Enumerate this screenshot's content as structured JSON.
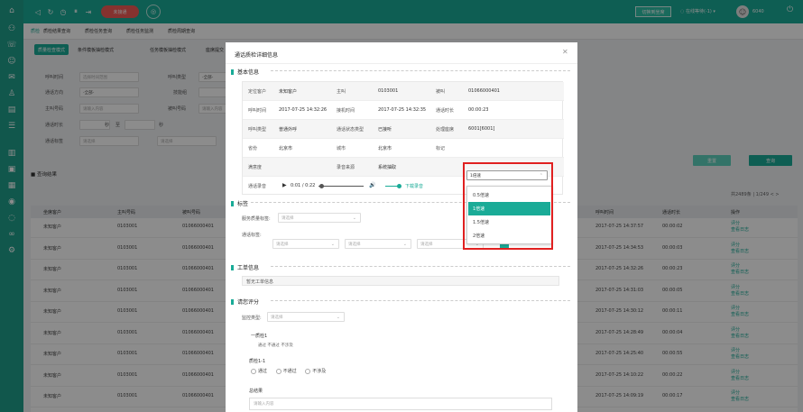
{
  "header": {
    "ringing_label": "未接通",
    "control_button": "切换到坐席",
    "status": "在线等待(-1)",
    "agent_id": "6040"
  },
  "nav_tabs": [
    "质检",
    "质检结果查询",
    "质检任务查询",
    "质检任务监测",
    "质检周期查询"
  ],
  "sub_tabs": [
    "质量检查模式",
    "条件模板抽检模式",
    "任务模板抽检模式",
    "座席提交"
  ],
  "filters": {
    "call_time_label": "呼叫时间",
    "call_time_placeholder": "选择时间范围",
    "call_type_label": "呼叫类型",
    "call_type_value": "-全部-",
    "call_direction_label": "通话方向",
    "call_direction_value": "-全部-",
    "skill_label": "技能组",
    "caller_label": "主叫号码",
    "caller_placeholder": "请输入内容",
    "called_label": "被叫号码",
    "called_placeholder": "请输入内容",
    "duration_label": "通话时长",
    "duration_sec": "秒",
    "duration_to": "至",
    "tag_label": "通话标签",
    "tag_placeholder": "请选择",
    "search_button": "查询",
    "reset_button": "重置"
  },
  "results": {
    "title": "查询结果",
    "pagination": "共2489条 | 1/249 < >"
  },
  "table": {
    "headers": [
      "坐席客户",
      "主叫号码",
      "被叫号码",
      "呼叫时间",
      "通话时长",
      "操作"
    ],
    "rows": [
      {
        "customer": "未知客户",
        "caller": "0103001",
        "called": "01066000401",
        "time": "2017-07-25 14:37:57",
        "duration": "00:00:02"
      },
      {
        "customer": "未知客户",
        "caller": "0103001",
        "called": "01066000401",
        "time": "2017-07-25 14:34:53",
        "duration": "00:00:03"
      },
      {
        "customer": "未知客户",
        "caller": "0103001",
        "called": "01066000401",
        "time": "2017-07-25 14:32:26",
        "duration": "00:00:23"
      },
      {
        "customer": "未知客户",
        "caller": "0103001",
        "called": "01066000401",
        "time": "2017-07-25 14:31:03",
        "duration": "00:00:05"
      },
      {
        "customer": "未知客户",
        "caller": "0103001",
        "called": "01066000401",
        "time": "2017-07-25 14:30:12",
        "duration": "00:00:11"
      },
      {
        "customer": "未知客户",
        "caller": "0103001",
        "called": "01066000401",
        "time": "2017-07-25 14:28:49",
        "duration": "00:00:04"
      },
      {
        "customer": "未知客户",
        "caller": "0103001",
        "called": "01066000401",
        "time": "2017-07-25 14:25:40",
        "duration": "00:00:55"
      },
      {
        "customer": "未知客户",
        "caller": "0103001",
        "called": "01066000401",
        "time": "2017-07-25 14:10:22",
        "duration": "00:00:22"
      },
      {
        "customer": "未知客户",
        "caller": "0103001",
        "called": "01066000401",
        "time": "2017-07-25 14:09:19",
        "duration": "00:00:17"
      }
    ],
    "action_score": "评分",
    "action_log": "查看日志"
  },
  "modal": {
    "title": "通话质检详细信息",
    "basic_info": "基本信息",
    "info": {
      "r1": [
        "定位客户",
        "未知客户",
        "主叫",
        "0103001",
        "被叫",
        "01066000401"
      ],
      "r2": [
        "呼叫时间",
        "2017-07-25 14:32:26",
        "接机时间",
        "2017-07-25 14:32:35",
        "通话时长",
        "00:00:23"
      ],
      "r3": [
        "呼叫类型",
        "普通外呼",
        "通话状态类型",
        "已接听",
        "处理座席",
        "6001[6001]"
      ],
      "r4": [
        "省份",
        "北京市",
        "城市",
        "北京市",
        "标记",
        ""
      ],
      "r5": [
        "满意度",
        "",
        "录音来源",
        "系统抽取"
      ],
      "r6_label": "通话录音",
      "time_display": "0:01 / 0:22",
      "download": "下载录音",
      "progress": 0.05,
      "volume": 0.8
    },
    "speed": {
      "selected": "1倍速",
      "options": [
        "0.5倍速",
        "1倍速",
        "1.5倍速",
        "2倍速"
      ]
    },
    "tags_section": "标签",
    "tags": {
      "service_label": "服务质量标签:",
      "service_placeholder": "请选择",
      "call_tag_label": "通话标签:",
      "placeholder": "请选择"
    },
    "ticket_section": "工单信息",
    "ticket_value": "暂无工单信息",
    "score_section": "请您评分",
    "score": {
      "template_label": "监控类型:",
      "template_placeholder": "请选择",
      "level1": "一质检1",
      "level1_desc": "通过 不通过 不涉及",
      "level2": "质检1-1",
      "radio_pass": "通过",
      "radio_fail": "不通过",
      "radio_na": "不涉及",
      "summary_label": "总结果",
      "summary_placeholder": "请输入内容"
    }
  }
}
